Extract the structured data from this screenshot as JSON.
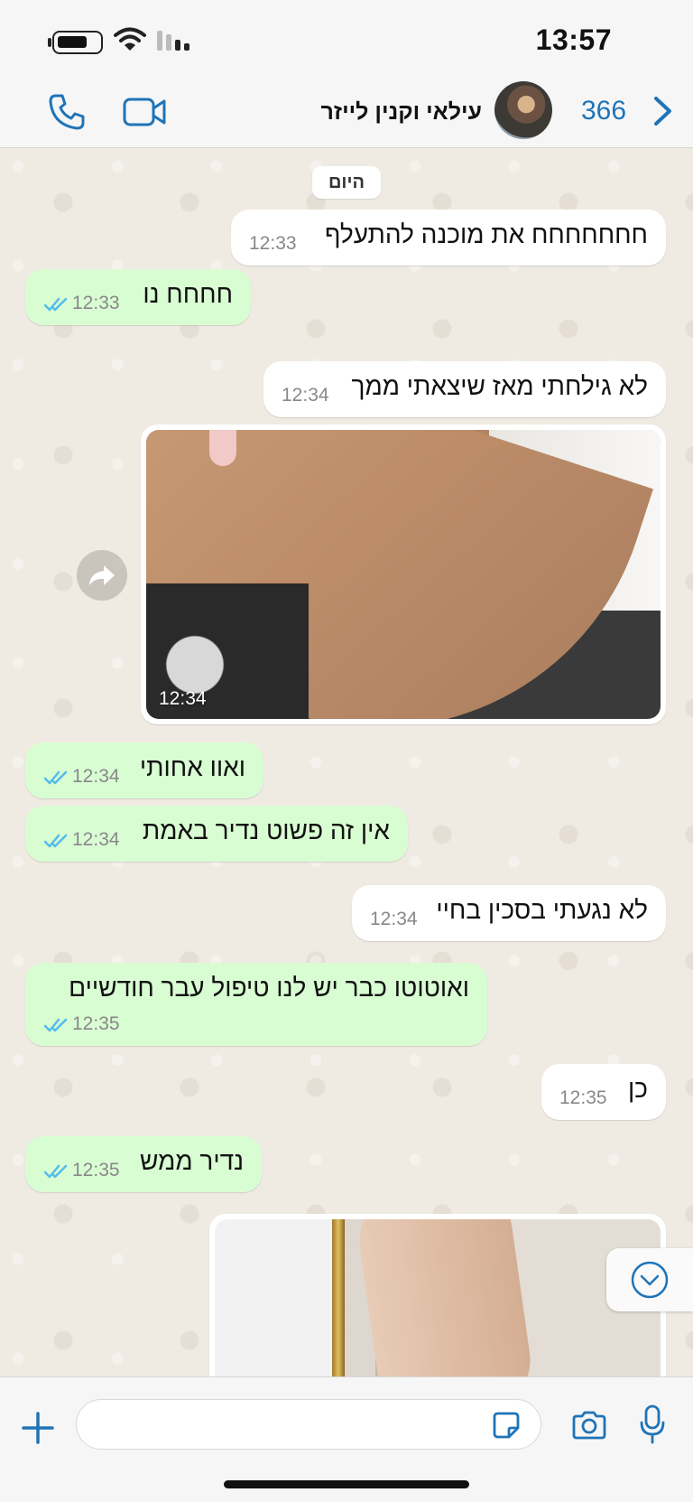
{
  "status_bar": {
    "time": "13:57"
  },
  "header": {
    "contact_name": "עילאי וקנין לייזר",
    "unread_count": "366"
  },
  "chat": {
    "day_label": "היום",
    "messages": [
      {
        "dir": "in",
        "text": "חחחחחחח את מוכנה להתעלף",
        "time": "12:33"
      },
      {
        "dir": "out",
        "text": "חחחח נו",
        "time": "12:33"
      },
      {
        "dir": "in",
        "text": "לא גילחתי מאז שיצאתי ממך",
        "time": "12:34"
      },
      {
        "dir": "in",
        "type": "photo",
        "time": "12:34"
      },
      {
        "dir": "out",
        "text": "ואוו אחותי",
        "time": "12:34"
      },
      {
        "dir": "out",
        "text": "אין זה פשוט נדיר באמת",
        "time": "12:34"
      },
      {
        "dir": "in",
        "text": "לא נגעתי בסכין בחיי",
        "time": "12:34"
      },
      {
        "dir": "out",
        "text": "ואוטוטו כבר יש לנו טיפול עבר חודשיים",
        "time": "12:35"
      },
      {
        "dir": "in",
        "text": "כן",
        "time": "12:35"
      },
      {
        "dir": "out",
        "text": "נדיר ממש",
        "time": "12:35"
      },
      {
        "dir": "in",
        "type": "photo"
      }
    ]
  },
  "input": {
    "value": "",
    "placeholder": ""
  },
  "colors": {
    "accent": "#1f74b8",
    "outgoing_bubble": "#d9fdd3",
    "incoming_bubble": "#ffffff",
    "read_ticks": "#53bdeb",
    "chat_background": "#efeae2"
  },
  "icons": {
    "call": "phone-icon",
    "video": "video-camera-icon",
    "back": "chevron-right-icon",
    "forward": "forward-arrow-icon",
    "scroll_down": "chevron-down-circle-icon",
    "attach": "plus-icon",
    "sticker": "sticker-icon",
    "camera": "camera-icon",
    "mic": "microphone-icon"
  }
}
